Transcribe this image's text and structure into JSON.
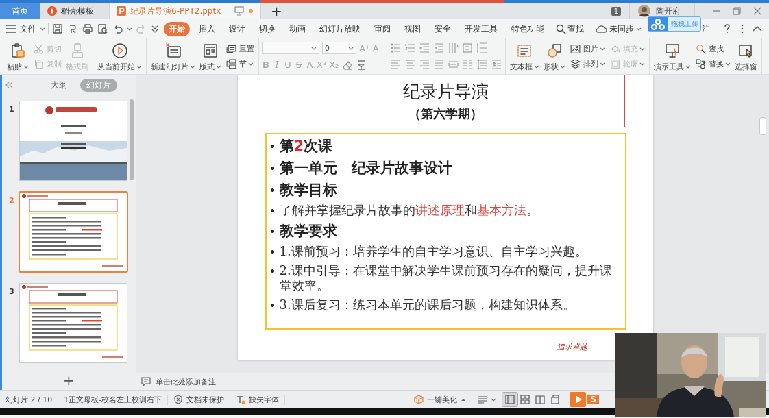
{
  "tabs": [
    {
      "label": "首页",
      "kind": "home",
      "selected": false
    },
    {
      "label": "稻壳模板",
      "kind": "template",
      "selected": false
    },
    {
      "label": "纪录片导演6-PPT2.pptx",
      "kind": "document",
      "selected": true,
      "unsaved": true
    }
  ],
  "new_tab": "+",
  "notification_count": "1",
  "user": {
    "name": "陶开府"
  },
  "menu": {
    "file": "文件",
    "tabs": [
      {
        "label": "开始",
        "selected": true
      },
      {
        "label": "插入",
        "selected": false
      },
      {
        "label": "设计",
        "selected": false
      },
      {
        "label": "切换",
        "selected": false
      },
      {
        "label": "动画",
        "selected": false
      },
      {
        "label": "幻灯片放映",
        "selected": false
      },
      {
        "label": "审阅",
        "selected": false
      },
      {
        "label": "视图",
        "selected": false
      },
      {
        "label": "安全",
        "selected": false
      },
      {
        "label": "开发工具",
        "selected": false
      },
      {
        "label": "特色功能",
        "selected": false
      }
    ],
    "search": "查找",
    "sync": "未同步",
    "comment_partial": "注",
    "upload_popup": "拖拽上传"
  },
  "ribbon": [
    {
      "items": [
        {
          "label": "粘贴",
          "kind": "large",
          "dropdown": true,
          "disabled": false
        },
        {
          "label": "剪切",
          "kind": "small",
          "dropdown": false,
          "disabled": true
        },
        {
          "label": "复制",
          "kind": "small",
          "dropdown": false,
          "disabled": true
        },
        {
          "label": "格式刷",
          "kind": "large",
          "dropdown": false,
          "disabled": true
        }
      ]
    },
    {
      "items": [
        {
          "label": "从当前开始",
          "kind": "large",
          "dropdown": true,
          "disabled": false
        }
      ]
    },
    {
      "items": [
        {
          "label": "新建幻灯片",
          "kind": "large",
          "dropdown": true,
          "disabled": false
        },
        {
          "label": "版式",
          "kind": "large",
          "dropdown": true,
          "disabled": false
        },
        {
          "label": "重置",
          "kind": "small",
          "dropdown": false,
          "disabled": false
        },
        {
          "label": "节",
          "kind": "small",
          "dropdown": true,
          "disabled": false
        }
      ]
    },
    {
      "kind": "font",
      "font_size": "0",
      "size_buttons": [
        "A⁺",
        "A⁻"
      ],
      "format_buttons": [
        "B",
        "I",
        "U",
        "S",
        "A",
        "X²",
        "X₂"
      ]
    },
    {
      "kind": "paragraph"
    },
    {
      "items": [
        {
          "label": "文本框",
          "kind": "large",
          "dropdown": true,
          "disabled": false
        },
        {
          "label": "形状",
          "kind": "large",
          "dropdown": true,
          "disabled": false
        },
        {
          "label": "图片",
          "kind": "small",
          "dropdown": true,
          "disabled": false
        },
        {
          "label": "排列",
          "kind": "small",
          "dropdown": true,
          "disabled": false
        },
        {
          "label": "填充",
          "kind": "small",
          "dropdown": true,
          "disabled": true
        },
        {
          "label": "轮廓",
          "kind": "small",
          "dropdown": true,
          "disabled": true
        }
      ]
    },
    {
      "items": [
        {
          "label": "演示工具",
          "kind": "large",
          "dropdown": true,
          "disabled": false
        },
        {
          "label": "查找",
          "kind": "small",
          "dropdown": false,
          "disabled": false
        },
        {
          "label": "替换",
          "kind": "small",
          "dropdown": true,
          "disabled": false
        },
        {
          "label": "选择窗",
          "kind": "large",
          "dropdown": false,
          "disabled": false
        }
      ]
    }
  ],
  "panel": {
    "tabs": [
      {
        "label": "大纲",
        "selected": false
      },
      {
        "label": "幻灯片",
        "selected": true
      }
    ],
    "thumbnails": [
      {
        "number": "1",
        "kind": "title",
        "selected": false
      },
      {
        "number": "2",
        "kind": "content",
        "selected": true
      },
      {
        "number": "3",
        "kind": "content",
        "selected": false
      }
    ],
    "add": "+"
  },
  "slide": {
    "title": "纪录片导演",
    "subtitle": "（第六学期）",
    "bullets": [
      {
        "kind": "heading",
        "parts": [
          {
            "text": "第"
          },
          {
            "text": "2",
            "highlight": true
          },
          {
            "text": "次课"
          }
        ]
      },
      {
        "kind": "heading",
        "parts": [
          {
            "text": "第一单元　纪录片故事设计"
          }
        ]
      },
      {
        "kind": "heading",
        "parts": [
          {
            "text": "教学目标"
          }
        ]
      },
      {
        "kind": "body",
        "parts": [
          {
            "text": "了解并掌握纪录片故事的"
          },
          {
            "text": "讲述原理",
            "highlight": true
          },
          {
            "text": "和"
          },
          {
            "text": "基本方法",
            "highlight": true
          },
          {
            "text": "。"
          }
        ]
      },
      {
        "kind": "heading",
        "parts": [
          {
            "text": "教学要求"
          }
        ]
      },
      {
        "kind": "body",
        "parts": [
          {
            "text": "1.课前预习：培养学生的自主学习意识、自主学习兴趣。"
          }
        ]
      },
      {
        "kind": "body",
        "parts": [
          {
            "text": "2.课中引导：在课堂中解决学生课前预习存在的疑问，提升课堂效率。"
          }
        ]
      },
      {
        "kind": "body",
        "parts": [
          {
            "text": "3.课后复习：练习本单元的课后习题，构建知识体系。"
          }
        ]
      }
    ],
    "footer": "追求卓越"
  },
  "notes_placeholder": "单击此处添加备注",
  "status_bar": {
    "slide": "幻灯片 2 / 10",
    "master": "1正文母板-校名左上校训右下",
    "protection": "文档未保护",
    "fonts": "缺失字体",
    "beautify": "一键美化",
    "views": [
      {
        "selected": true
      },
      {
        "selected": false
      },
      {
        "selected": false
      },
      {
        "selected": false
      }
    ],
    "ime": "S"
  }
}
